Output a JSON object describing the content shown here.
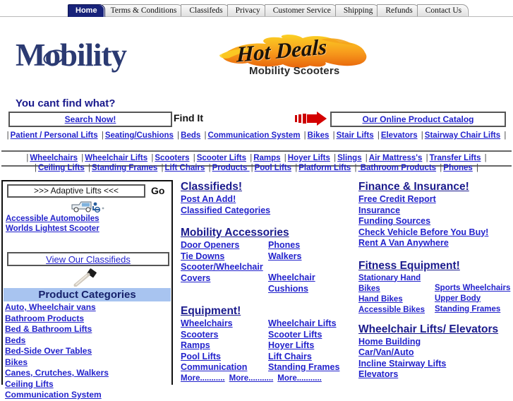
{
  "tabs": [
    {
      "label": "Home",
      "active": true
    },
    {
      "label": "Terms & Conditions",
      "active": false
    },
    {
      "label": "Classifeds",
      "active": false
    },
    {
      "label": "Privacy",
      "active": false
    },
    {
      "label": "Customer Service",
      "active": false
    },
    {
      "label": "Shipping",
      "active": false
    },
    {
      "label": "Refunds",
      "active": false
    },
    {
      "label": "Contact Us",
      "active": false
    }
  ],
  "logo": {
    "primary_pre": "M",
    "primary_o": "o",
    "primary_post": "bility",
    "hotdeals_script": "Hot Deals",
    "hotdeals_sub": "Mobility Scooters",
    "primary_color": "#2b3a72",
    "flame_orange": "#f07c12",
    "flame_yellow": "#fbd024"
  },
  "search": {
    "tagline": "You cant find what?",
    "search_now": "Search Now!",
    "find_it": "Find It",
    "catalog": "Our Online Product Catalog",
    "arrow_color": "#cc0000"
  },
  "nav_row1": [
    "Patient / Personal Lifts",
    "Seating/Cushions",
    "Beds",
    "Communication System",
    "Bikes",
    "Stair Lifts",
    "Elevators",
    "Stairway Chair Lifts"
  ],
  "nav_row2": [
    "Wheelchairs",
    "Wheelchair Lifts",
    "Scooters",
    "Scooter Lifts",
    "Ramps",
    "Hoyer Lifts",
    "Slings",
    "Air Mattress's",
    "Transfer Lifts"
  ],
  "nav_row3": [
    "Ceiling Lifts",
    "Standing Frames",
    "Lift Chairs",
    "Products ",
    "Pool Lifts",
    "Platform Lifts",
    " Bathroom Products",
    "Phones"
  ],
  "sidebar": {
    "select_value": ">>> Adaptive Lifts <<<",
    "go_label": "Go",
    "quick_links": [
      "Accessible Automobiles",
      "Worlds Lightest Scooter"
    ],
    "classifieds_button": "View Our Classifieds",
    "categories_header": "Product Categories",
    "categories": [
      "Auto, Wheelchair vans",
      "Bathroom Products",
      "Bed & Bathroom Lifts",
      "Beds",
      "Bed-Side Over Tables",
      "Bikes",
      "Canes, Crutches, Walkers",
      "Ceiling Lifts",
      "Communication System"
    ],
    "header_bg": "#a8c4f0"
  },
  "middle": {
    "classifieds": {
      "heading": "Classifieds!",
      "links": [
        "Post An Add!",
        "Classified Categories"
      ]
    },
    "accessories": {
      "heading": "Mobility Accessories",
      "col1": [
        "Door Openers",
        " Tie Downs",
        "Scooter/Wheelchair Covers"
      ],
      "col2": [
        "Phones",
        "Walkers",
        "Wheelchair Cushions"
      ]
    },
    "equipment": {
      "heading": "Equipment!",
      "col1": [
        "Wheelchairs",
        "Scooters",
        "Ramps",
        "Pool Lifts",
        "Communication"
      ],
      "col2": [
        "Wheelchair Lifts",
        "Scooter Lifts",
        "Hoyer Lifts",
        "Lift Chairs",
        "Standing Frames"
      ],
      "more": [
        "More...........",
        "More...........",
        "More..........."
      ]
    }
  },
  "right": {
    "finance": {
      "heading": "Finance & Insurance!",
      "links": [
        "Free Credit Report",
        "Insurance",
        "Funding Sources",
        "Check Vehicle Before You Buy!",
        "Rent A Van Anywhere"
      ]
    },
    "fitness": {
      "heading": "Fitness Equipment!",
      "col1": [
        "Stationary Hand Bikes",
        "Hand Bikes",
        "Accessible Bikes"
      ],
      "col2": [
        "Sports Wheelchairs",
        "Upper Body",
        "Standing Frames"
      ]
    },
    "lifts": {
      "heading": "Wheelchair Lifts/ Elevators",
      "links": [
        "Home Building",
        "Car/Van/Auto",
        "Incline Stairway Lifts",
        "Elevators"
      ]
    }
  }
}
